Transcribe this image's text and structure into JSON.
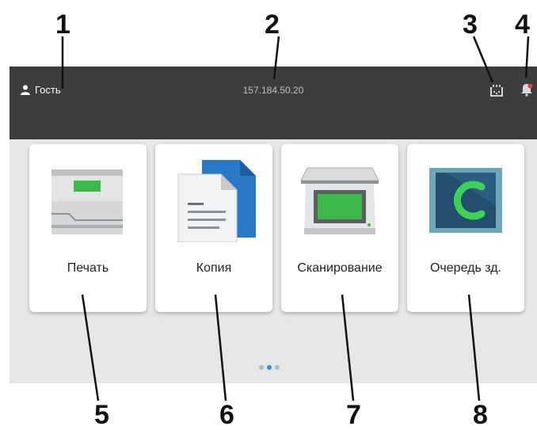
{
  "callouts": [
    "1",
    "2",
    "3",
    "4",
    "5",
    "6",
    "7",
    "8"
  ],
  "header": {
    "user_label": "Гость",
    "ip_address": "157.184.50.20",
    "icons": [
      "user-icon",
      "supplies-icon",
      "notification-bell-icon"
    ]
  },
  "tiles": [
    {
      "label": "Печать",
      "icon": "printer-icon"
    },
    {
      "label": "Копия",
      "icon": "copy-icon"
    },
    {
      "label": "Сканирование",
      "icon": "scanner-icon"
    },
    {
      "label": "Очередь зд.",
      "icon": "job-queue-icon"
    }
  ],
  "pagination": {
    "total": 3,
    "active": 2
  },
  "colors": {
    "topbar": "#3d3d3d",
    "screen_bg": "#e6e7e8",
    "accent_green": "#3cb94a",
    "active_dot": "#2d8fd8",
    "notification_badge": "#e53935"
  }
}
